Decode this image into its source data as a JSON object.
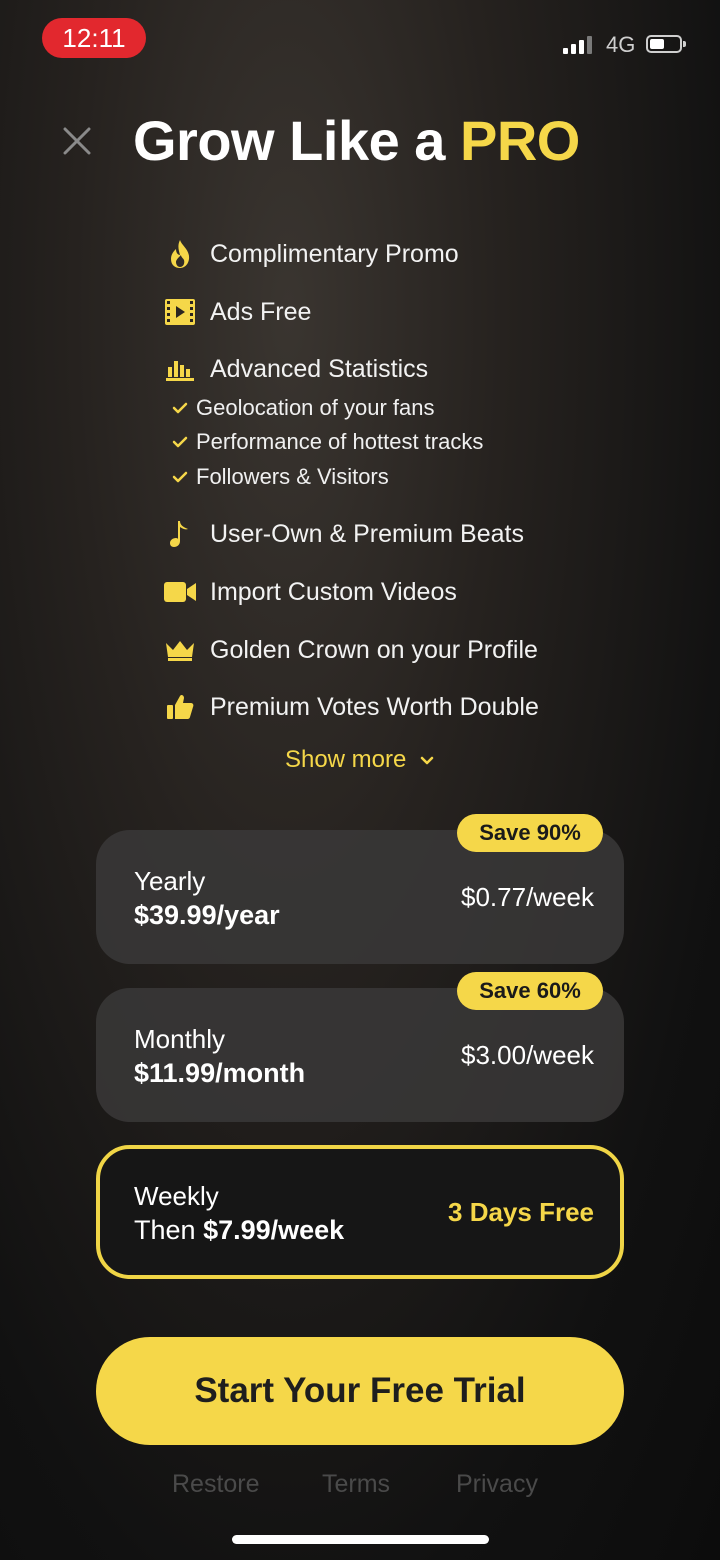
{
  "status_bar": {
    "time": "12:11",
    "network": "4G"
  },
  "header": {
    "title_prefix": "Grow Like a",
    "title_highlight": "PRO"
  },
  "features": [
    {
      "label": "Complimentary Promo",
      "icon": "flame-icon"
    },
    {
      "label": "Ads Free",
      "icon": "film-play-icon"
    },
    {
      "label": "Advanced Statistics",
      "icon": "bar-chart-icon"
    },
    {
      "label": "User-Own & Premium Beats",
      "icon": "music-note-icon"
    },
    {
      "label": "Import Custom Videos",
      "icon": "video-camera-icon"
    },
    {
      "label": "Golden Crown on your Profile",
      "icon": "crown-icon"
    },
    {
      "label": "Premium Votes Worth Double",
      "icon": "thumbs-up-icon"
    }
  ],
  "statistics_subfeatures": [
    "Geolocation of your fans",
    "Performance of hottest tracks",
    "Followers & Visitors"
  ],
  "show_more_label": "Show more",
  "plans": [
    {
      "name": "Yearly",
      "price": "$39.99/year",
      "per_week": "$0.77/week",
      "badge": "Save 90%",
      "selected": false
    },
    {
      "name": "Monthly",
      "price": "$11.99/month",
      "per_week": "$3.00/week",
      "badge": "Save 60%",
      "selected": false
    },
    {
      "name": "Weekly",
      "price_prefix": "Then",
      "price": "$7.99/week",
      "trial": "3 Days Free",
      "selected": true
    }
  ],
  "cta_label": "Start Your Free Trial",
  "footer": {
    "restore": "Restore",
    "terms": "Terms",
    "privacy": "Privacy"
  },
  "colors": {
    "accent": "#f5d749",
    "status_pill": "#e2282e",
    "card": "#3a3838",
    "footer_text": "#4a4a4a"
  }
}
